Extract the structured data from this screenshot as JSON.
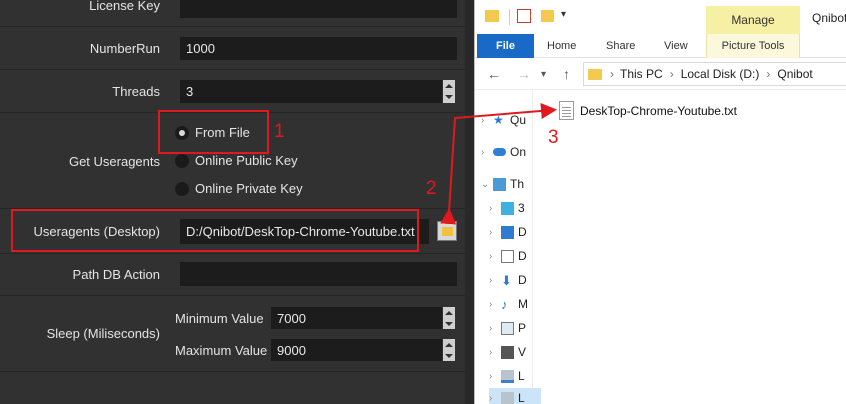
{
  "settings": {
    "license_label": "License Key",
    "license_value": "",
    "numberrun_label": "NumberRun",
    "numberrun_value": "1000",
    "threads_label": "Threads",
    "threads_value": "3",
    "useragents_group_label": "Get Useragents",
    "radio_options": [
      "From File",
      "Online Public Key",
      "Online Private Key"
    ],
    "radio_selected": "From File",
    "desktop_label": "Useragents (Desktop)",
    "desktop_value": "D:/Qnibot/DeskTop-Chrome-Youtube.txt",
    "pathdb_label": "Path DB Action",
    "pathdb_value": "",
    "sleep_label": "Sleep (Miliseconds)",
    "min_label": "Minimum Value",
    "min_value": "7000",
    "max_label": "Maximum Value",
    "max_value": "9000"
  },
  "annotations": {
    "step1": "1",
    "step2": "2",
    "step3": "3",
    "color": "#e0191f"
  },
  "explorer": {
    "context_tab": "Manage",
    "window_title": "Qnibot",
    "ribbon_tabs": [
      "File",
      "Home",
      "Share",
      "View",
      "Picture Tools"
    ],
    "breadcrumb": [
      "This PC",
      "Local Disk (D:)",
      "Qnibot"
    ],
    "nav_items": [
      "Qu",
      "On",
      "Th",
      "3",
      "D",
      "D",
      "D",
      "M",
      "P",
      "V",
      "L",
      "L"
    ],
    "file_name": "DeskTop-Chrome-Youtube.txt"
  }
}
